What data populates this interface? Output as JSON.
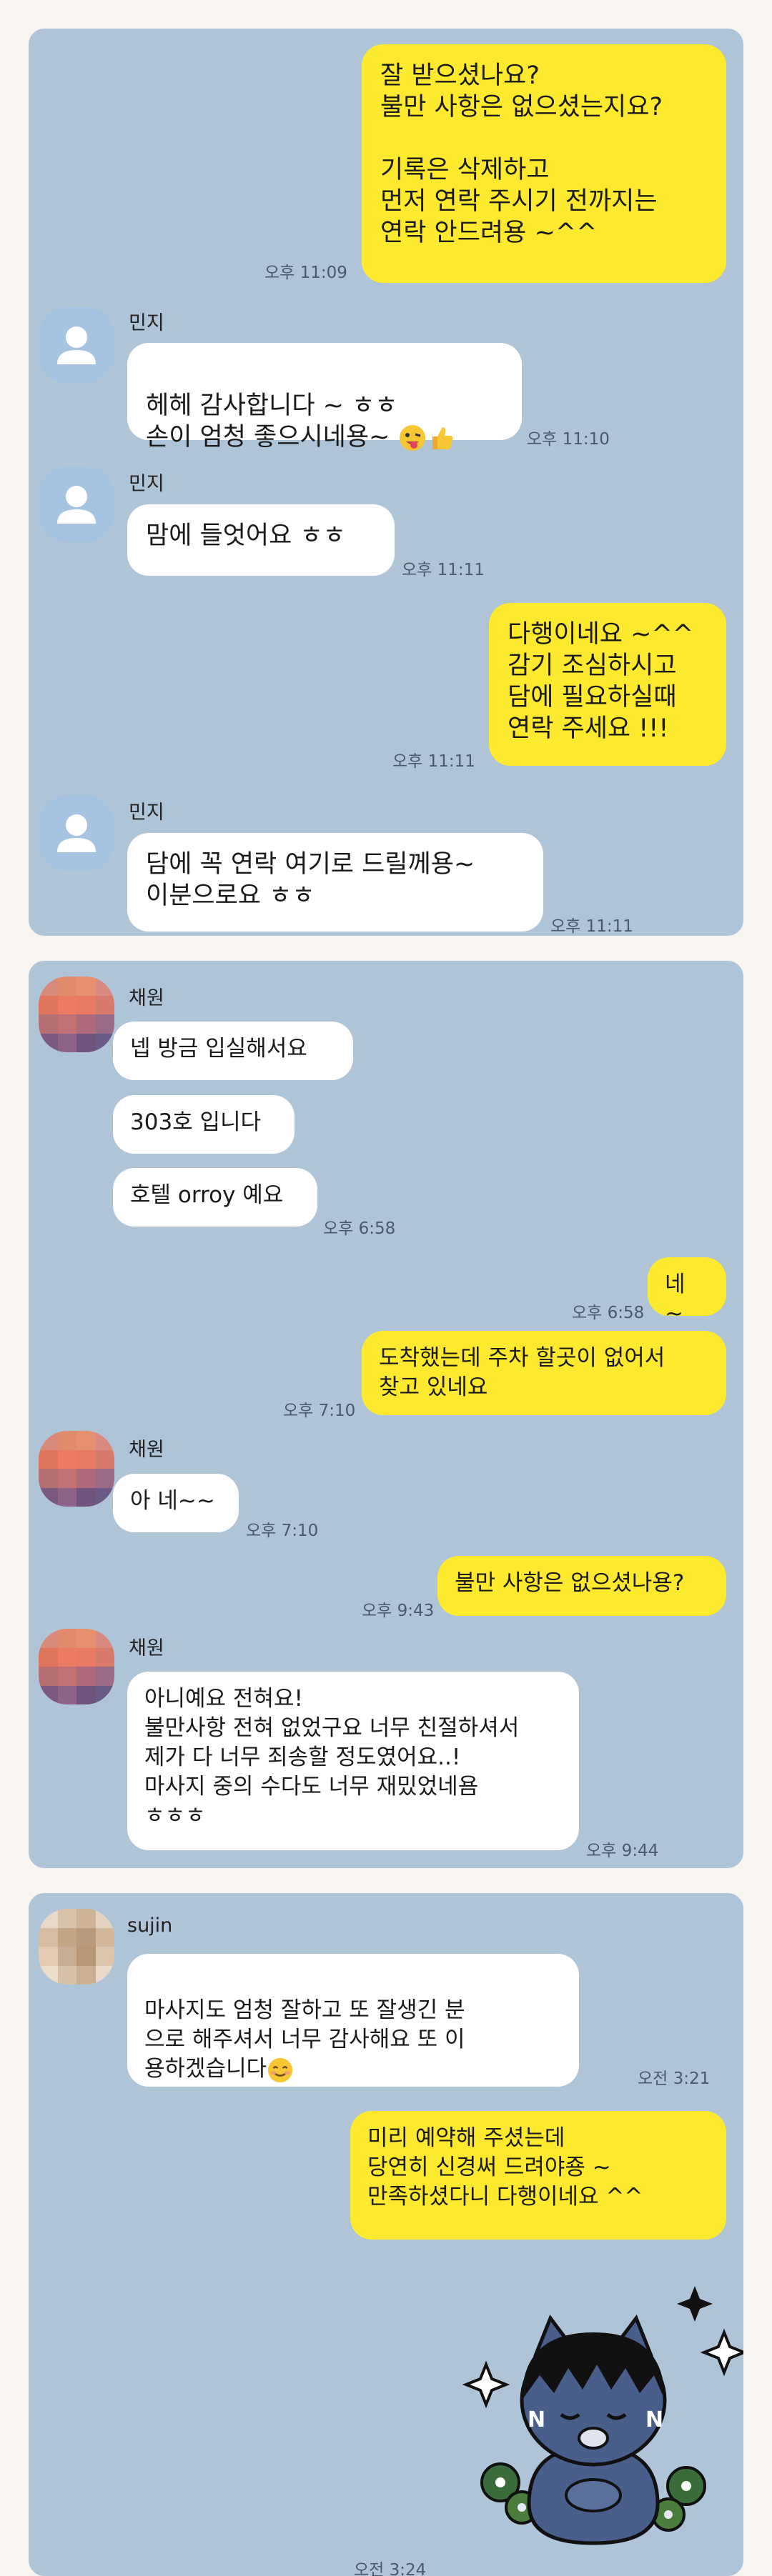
{
  "chat1": {
    "messages": [
      {
        "text": "잘 받으셨나요?\n불만 사항은 없으셨는지요?\n\n기록은 삭제하고\n먼저 연락 주시기 전까지는\n연락 안드려용 ~^^",
        "time": "오후 11:09"
      },
      {
        "sender": "민지",
        "text": "헤헤 감사합니다 ~ ㅎㅎ\n손이 엄청 좋으시네용~ ",
        "time": "오후 11:10"
      },
      {
        "sender": "민지",
        "text": "맘에 들엇어요 ㅎㅎ",
        "time": "오후 11:11"
      },
      {
        "text": "다행이네요 ~^^\n감기 조심하시고\n담에 필요하실때\n연락 주세요 !!!",
        "time": "오후 11:11"
      },
      {
        "sender": "민지",
        "text": "담에 꼭 연락 여기로 드릴께용~\n이분으로요 ㅎㅎ",
        "time": "오후 11:11"
      }
    ]
  },
  "chat2": {
    "messages": [
      {
        "sender": "채원",
        "text": "넵 방금 입실해서요"
      },
      {
        "text": "303호 입니다"
      },
      {
        "text": "호텔 orroy 예요",
        "time": "오후 6:58"
      },
      {
        "text": "네 ~",
        "time": "오후 6:58"
      },
      {
        "text": "도착했는데  주차 할곳이 없어서\n찾고 있네요",
        "time": "오후 7:10"
      },
      {
        "sender": "채원",
        "text": "아 네~~",
        "time": "오후 7:10"
      },
      {
        "text": "불만 사항은 없으셨나용?",
        "time": "오후 9:43"
      },
      {
        "sender": "채원",
        "text": "아니예요 전혀요!\n불만사항 전혀 없었구요 너무 친절하셔서\n제가 다 너무 죄송할 정도였어요..!\n마사지 중의 수다도 너무 재밌었네욤\nㅎㅎㅎ",
        "time": "오후 9:44"
      }
    ]
  },
  "chat3": {
    "messages": [
      {
        "sender": "sujin",
        "text": "마사지도 엄청 잘하고 또 잘생긴 분\n으로 해주셔서 너무 감사해요 또 이\n용하겠습니다",
        "time": "오전 3:21"
      },
      {
        "text": "미리 예약해 주셨는데\n당연히 신경써 드려야죵 ~\n만족하셨다니 다행이네요 ^^"
      },
      {
        "sticker": "kakao-friend-sticker",
        "time": "오전 3:24"
      }
    ]
  },
  "colors": {
    "incoming": "#ffffff",
    "outgoing": "#fdea2e",
    "background": "#b0c4d8"
  },
  "icons": [
    "default-profile-icon",
    "winking-tongue-emoji",
    "thumbs-up-emoji",
    "smiling-emoji"
  ]
}
